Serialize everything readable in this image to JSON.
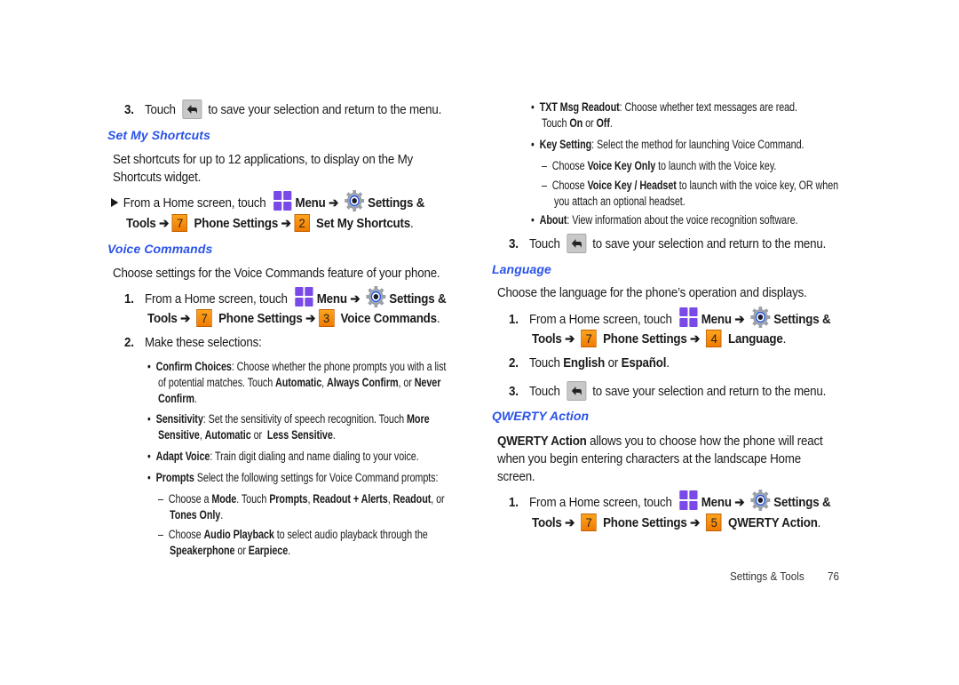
{
  "left": {
    "step3_back": {
      "num": "3.",
      "pre": "Touch",
      "post": "to save your selection and return to the menu."
    },
    "set_my_shortcuts": {
      "heading": "Set My Shortcuts",
      "desc_line1": "Set shortcuts for up to 12 applications, to display on the My",
      "desc_line2": "Shortcuts widget.",
      "path": {
        "from": "From a Home screen, touch",
        "menu": "Menu ➔",
        "settings": "Settings &",
        "tools": "Tools ➔",
        "key1": "7",
        "phone_settings": "Phone Settings",
        "arrow": "➔",
        "key2": "2",
        "target": "Set My Shortcuts",
        "end": "."
      }
    },
    "voice_commands": {
      "heading": "Voice Commands",
      "desc": "Choose settings for the Voice Commands feature of your phone.",
      "step1": {
        "num": "1.",
        "from": "From a Home screen, touch",
        "menu": "Menu ➔",
        "settings": "Settings &",
        "tools": "Tools ➔",
        "key1": "7",
        "phone_settings": "Phone Settings ➔",
        "key2": "3",
        "target": "Voice Commands",
        "end": "."
      },
      "step2": {
        "num": "2.",
        "text": "Make these selections:"
      },
      "bullets": {
        "confirm": {
          "b": "Confirm Choices",
          "t1": ": Choose whether the phone prompts you with a list",
          "t2": "of potential matches. Touch ",
          "o1": "Automatic",
          "c1": ", ",
          "o2": "Always Confirm",
          "c2": ", or ",
          "o3": "Never",
          "o4": "Confirm",
          "end": "."
        },
        "sensitivity": {
          "b": "Sensitivity",
          "t1": ": Set the sensitivity of speech recognition.  Touch ",
          "o1": "More",
          "o2": "Sensitive",
          "c1": ", ",
          "o3": "Automatic",
          "c2": " or  ",
          "o4": "Less Sensitive",
          "end": "."
        },
        "adapt": {
          "b": "Adapt Voice",
          "t1": ": Train digit dialing and name dialing to your voice."
        },
        "prompts": {
          "b": "Prompts",
          "t1": " Select the following settings for Voice Command prompts:"
        }
      },
      "sub": {
        "mode": {
          "dash": "–",
          "t1": "Choose a ",
          "b1": "Mode",
          "t2": ". Touch ",
          "o1": "Prompts",
          "c1": ", ",
          "o2": "Readout + Alerts",
          "c2": ", ",
          "o3": "Readout",
          "c3": ", or",
          "o4": "Tones Only",
          "end": "."
        },
        "audio": {
          "dash": "–",
          "t1": "Choose ",
          "b1": "Audio Playback",
          "t2": " to select audio playback through the",
          "o1": "Speakerphone",
          "c1": " or ",
          "o2": "Earpiece",
          "end": "."
        }
      }
    }
  },
  "right": {
    "txt_msg": {
      "b": "TXT Msg Readout",
      "t1": ": Choose whether text messages are read.",
      "t2": "Touch ",
      "o1": "On",
      "c1": " or ",
      "o2": "Off",
      "end": "."
    },
    "key_setting": {
      "b": "Key Setting",
      "t1": ": Select the method for launching Voice Command."
    },
    "key_sub1": {
      "dash": "–",
      "t1": "Choose ",
      "b1": "Voice Key Only",
      "t2": " to launch with the Voice key."
    },
    "key_sub2": {
      "dash": "–",
      "t1": "Choose ",
      "b1": "Voice Key / Headset",
      "t2": " to launch with the voice key, OR when",
      "t3": "you attach an optional headset."
    },
    "about": {
      "b": "About",
      "t1": ": View information about the voice recognition software."
    },
    "step3_back": {
      "num": "3.",
      "pre": "Touch",
      "post": "to save your selection and return to the menu."
    },
    "language": {
      "heading": "Language",
      "desc": "Choose the language for the phone’s operation and displays.",
      "step1": {
        "num": "1.",
        "from": "From a Home screen, touch",
        "menu": "Menu ➔",
        "settings": "Settings &",
        "tools": "Tools ➔",
        "key1": "7",
        "phone_settings": "Phone Settings ➔",
        "key2": "4",
        "target": "Language",
        "end": "."
      },
      "step2": {
        "num": "2.",
        "t1": "Touch ",
        "o1": "English",
        "c1": " or ",
        "o2": "Español",
        "end": "."
      },
      "step3": {
        "num": "3.",
        "pre": "Touch",
        "post": "to save your selection and return to the menu."
      }
    },
    "qwerty": {
      "heading": "QWERTY Action",
      "desc_b": "QWERTY Action",
      "desc_line1": " allows you to choose how the phone will react",
      "desc_line2": "when you begin entering characters at the landscape Home",
      "desc_line3": "screen.",
      "step1": {
        "num": "1.",
        "from": "From a Home screen, touch",
        "menu": "Menu ➔",
        "settings": "Settings &",
        "tools": "Tools ➔",
        "key1": "7",
        "phone_settings": "Phone Settings ➔",
        "key2": "5",
        "target": "QWERTY Action",
        "end": "."
      }
    },
    "footer": {
      "section": "Settings & Tools",
      "page": "76"
    }
  },
  "colors": {
    "heading": "#2a52e8",
    "menu_icon": "#7a4ae8",
    "key_orange": "#f28c0e",
    "gear_blue": "#1e4fd8"
  },
  "icons": {
    "back": "back-arrow-icon",
    "menu": "menu-grid-icon",
    "settings": "gear-icon",
    "key": "number-key-icon",
    "bullet_arrow": "triangle-right-icon"
  }
}
